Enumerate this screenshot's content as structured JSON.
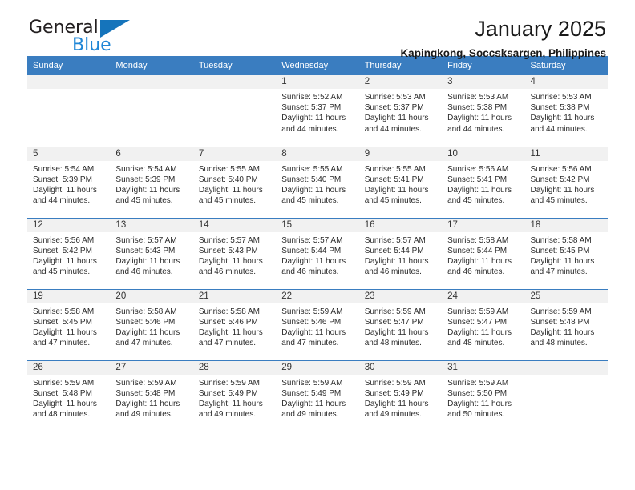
{
  "logo": {
    "word_top": "General",
    "word_bottom": "Blue",
    "accent_dark": "#231f20",
    "accent_blue": "#1f86d6",
    "triangle_color": "#1574bb"
  },
  "header": {
    "title": "January 2025",
    "subtitle": "Kapingkong, Soccsksargen, Philippines"
  },
  "theme": {
    "header_row_bg": "#3a7dc0",
    "daynum_bg": "#f1f1f1",
    "cell_bg": "#ffffff",
    "rule_color": "#3a7dc0"
  },
  "weekday_headers": [
    "Sunday",
    "Monday",
    "Tuesday",
    "Wednesday",
    "Thursday",
    "Friday",
    "Saturday"
  ],
  "labels": {
    "sunrise": "Sunrise:",
    "sunset": "Sunset:",
    "daylight": "Daylight:"
  },
  "weeks": [
    [
      {
        "day": "",
        "sunrise": "",
        "sunset": "",
        "daylight_line1": "",
        "daylight_line2": ""
      },
      {
        "day": "",
        "sunrise": "",
        "sunset": "",
        "daylight_line1": "",
        "daylight_line2": ""
      },
      {
        "day": "",
        "sunrise": "",
        "sunset": "",
        "daylight_line1": "",
        "daylight_line2": ""
      },
      {
        "day": "1",
        "sunrise": "Sunrise: 5:52 AM",
        "sunset": "Sunset: 5:37 PM",
        "daylight_line1": "Daylight: 11 hours",
        "daylight_line2": "and 44 minutes."
      },
      {
        "day": "2",
        "sunrise": "Sunrise: 5:53 AM",
        "sunset": "Sunset: 5:37 PM",
        "daylight_line1": "Daylight: 11 hours",
        "daylight_line2": "and 44 minutes."
      },
      {
        "day": "3",
        "sunrise": "Sunrise: 5:53 AM",
        "sunset": "Sunset: 5:38 PM",
        "daylight_line1": "Daylight: 11 hours",
        "daylight_line2": "and 44 minutes."
      },
      {
        "day": "4",
        "sunrise": "Sunrise: 5:53 AM",
        "sunset": "Sunset: 5:38 PM",
        "daylight_line1": "Daylight: 11 hours",
        "daylight_line2": "and 44 minutes."
      }
    ],
    [
      {
        "day": "5",
        "sunrise": "Sunrise: 5:54 AM",
        "sunset": "Sunset: 5:39 PM",
        "daylight_line1": "Daylight: 11 hours",
        "daylight_line2": "and 44 minutes."
      },
      {
        "day": "6",
        "sunrise": "Sunrise: 5:54 AM",
        "sunset": "Sunset: 5:39 PM",
        "daylight_line1": "Daylight: 11 hours",
        "daylight_line2": "and 45 minutes."
      },
      {
        "day": "7",
        "sunrise": "Sunrise: 5:55 AM",
        "sunset": "Sunset: 5:40 PM",
        "daylight_line1": "Daylight: 11 hours",
        "daylight_line2": "and 45 minutes."
      },
      {
        "day": "8",
        "sunrise": "Sunrise: 5:55 AM",
        "sunset": "Sunset: 5:40 PM",
        "daylight_line1": "Daylight: 11 hours",
        "daylight_line2": "and 45 minutes."
      },
      {
        "day": "9",
        "sunrise": "Sunrise: 5:55 AM",
        "sunset": "Sunset: 5:41 PM",
        "daylight_line1": "Daylight: 11 hours",
        "daylight_line2": "and 45 minutes."
      },
      {
        "day": "10",
        "sunrise": "Sunrise: 5:56 AM",
        "sunset": "Sunset: 5:41 PM",
        "daylight_line1": "Daylight: 11 hours",
        "daylight_line2": "and 45 minutes."
      },
      {
        "day": "11",
        "sunrise": "Sunrise: 5:56 AM",
        "sunset": "Sunset: 5:42 PM",
        "daylight_line1": "Daylight: 11 hours",
        "daylight_line2": "and 45 minutes."
      }
    ],
    [
      {
        "day": "12",
        "sunrise": "Sunrise: 5:56 AM",
        "sunset": "Sunset: 5:42 PM",
        "daylight_line1": "Daylight: 11 hours",
        "daylight_line2": "and 45 minutes."
      },
      {
        "day": "13",
        "sunrise": "Sunrise: 5:57 AM",
        "sunset": "Sunset: 5:43 PM",
        "daylight_line1": "Daylight: 11 hours",
        "daylight_line2": "and 46 minutes."
      },
      {
        "day": "14",
        "sunrise": "Sunrise: 5:57 AM",
        "sunset": "Sunset: 5:43 PM",
        "daylight_line1": "Daylight: 11 hours",
        "daylight_line2": "and 46 minutes."
      },
      {
        "day": "15",
        "sunrise": "Sunrise: 5:57 AM",
        "sunset": "Sunset: 5:44 PM",
        "daylight_line1": "Daylight: 11 hours",
        "daylight_line2": "and 46 minutes."
      },
      {
        "day": "16",
        "sunrise": "Sunrise: 5:57 AM",
        "sunset": "Sunset: 5:44 PM",
        "daylight_line1": "Daylight: 11 hours",
        "daylight_line2": "and 46 minutes."
      },
      {
        "day": "17",
        "sunrise": "Sunrise: 5:58 AM",
        "sunset": "Sunset: 5:44 PM",
        "daylight_line1": "Daylight: 11 hours",
        "daylight_line2": "and 46 minutes."
      },
      {
        "day": "18",
        "sunrise": "Sunrise: 5:58 AM",
        "sunset": "Sunset: 5:45 PM",
        "daylight_line1": "Daylight: 11 hours",
        "daylight_line2": "and 47 minutes."
      }
    ],
    [
      {
        "day": "19",
        "sunrise": "Sunrise: 5:58 AM",
        "sunset": "Sunset: 5:45 PM",
        "daylight_line1": "Daylight: 11 hours",
        "daylight_line2": "and 47 minutes."
      },
      {
        "day": "20",
        "sunrise": "Sunrise: 5:58 AM",
        "sunset": "Sunset: 5:46 PM",
        "daylight_line1": "Daylight: 11 hours",
        "daylight_line2": "and 47 minutes."
      },
      {
        "day": "21",
        "sunrise": "Sunrise: 5:58 AM",
        "sunset": "Sunset: 5:46 PM",
        "daylight_line1": "Daylight: 11 hours",
        "daylight_line2": "and 47 minutes."
      },
      {
        "day": "22",
        "sunrise": "Sunrise: 5:59 AM",
        "sunset": "Sunset: 5:46 PM",
        "daylight_line1": "Daylight: 11 hours",
        "daylight_line2": "and 47 minutes."
      },
      {
        "day": "23",
        "sunrise": "Sunrise: 5:59 AM",
        "sunset": "Sunset: 5:47 PM",
        "daylight_line1": "Daylight: 11 hours",
        "daylight_line2": "and 48 minutes."
      },
      {
        "day": "24",
        "sunrise": "Sunrise: 5:59 AM",
        "sunset": "Sunset: 5:47 PM",
        "daylight_line1": "Daylight: 11 hours",
        "daylight_line2": "and 48 minutes."
      },
      {
        "day": "25",
        "sunrise": "Sunrise: 5:59 AM",
        "sunset": "Sunset: 5:48 PM",
        "daylight_line1": "Daylight: 11 hours",
        "daylight_line2": "and 48 minutes."
      }
    ],
    [
      {
        "day": "26",
        "sunrise": "Sunrise: 5:59 AM",
        "sunset": "Sunset: 5:48 PM",
        "daylight_line1": "Daylight: 11 hours",
        "daylight_line2": "and 48 minutes."
      },
      {
        "day": "27",
        "sunrise": "Sunrise: 5:59 AM",
        "sunset": "Sunset: 5:48 PM",
        "daylight_line1": "Daylight: 11 hours",
        "daylight_line2": "and 49 minutes."
      },
      {
        "day": "28",
        "sunrise": "Sunrise: 5:59 AM",
        "sunset": "Sunset: 5:49 PM",
        "daylight_line1": "Daylight: 11 hours",
        "daylight_line2": "and 49 minutes."
      },
      {
        "day": "29",
        "sunrise": "Sunrise: 5:59 AM",
        "sunset": "Sunset: 5:49 PM",
        "daylight_line1": "Daylight: 11 hours",
        "daylight_line2": "and 49 minutes."
      },
      {
        "day": "30",
        "sunrise": "Sunrise: 5:59 AM",
        "sunset": "Sunset: 5:49 PM",
        "daylight_line1": "Daylight: 11 hours",
        "daylight_line2": "and 49 minutes."
      },
      {
        "day": "31",
        "sunrise": "Sunrise: 5:59 AM",
        "sunset": "Sunset: 5:50 PM",
        "daylight_line1": "Daylight: 11 hours",
        "daylight_line2": "and 50 minutes."
      },
      {
        "day": "",
        "sunrise": "",
        "sunset": "",
        "daylight_line1": "",
        "daylight_line2": ""
      }
    ]
  ]
}
